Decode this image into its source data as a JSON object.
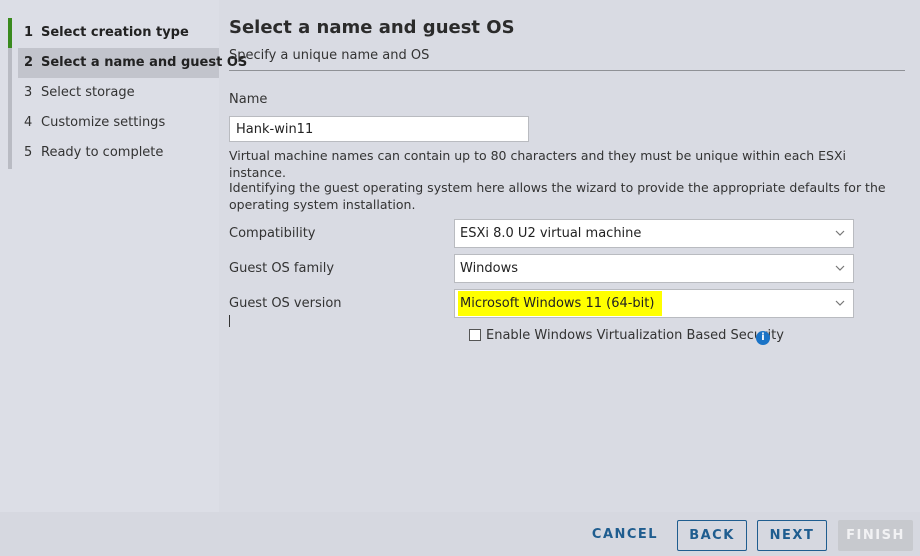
{
  "steps": [
    {
      "num": "1",
      "label": "Select creation type"
    },
    {
      "num": "2",
      "label": "Select a name and guest OS"
    },
    {
      "num": "3",
      "label": "Select storage"
    },
    {
      "num": "4",
      "label": "Customize settings"
    },
    {
      "num": "5",
      "label": "Ready to complete"
    }
  ],
  "page": {
    "title": "Select a name and guest OS",
    "subtitle": "Specify a unique name and OS"
  },
  "form": {
    "name_label": "Name",
    "name_value": "Hank-win11",
    "name_help": "Virtual machine names can contain up to 80 characters and they must be unique within each ESXi instance.",
    "os_help": "Identifying the guest operating system here allows the wizard to provide the appropriate defaults for the operating system installation.",
    "compatibility_label": "Compatibility",
    "compatibility_value": "ESXi 8.0 U2 virtual machine",
    "os_family_label": "Guest OS family",
    "os_family_value": "Windows",
    "os_version_label": "Guest OS version",
    "os_version_value": "Microsoft Windows 11 (64-bit)",
    "vbs_label": "Enable Windows Virtualization Based Security",
    "vbs_checked": false,
    "info_icon_glyph": "i"
  },
  "footer": {
    "cancel": "CANCEL",
    "back": "BACK",
    "next": "NEXT",
    "finish": "FINISH"
  },
  "colors": {
    "accent": "#1f5d8f",
    "active_step": "#3a8a1e",
    "highlight": "#ffff00",
    "info": "#1a73c6"
  }
}
